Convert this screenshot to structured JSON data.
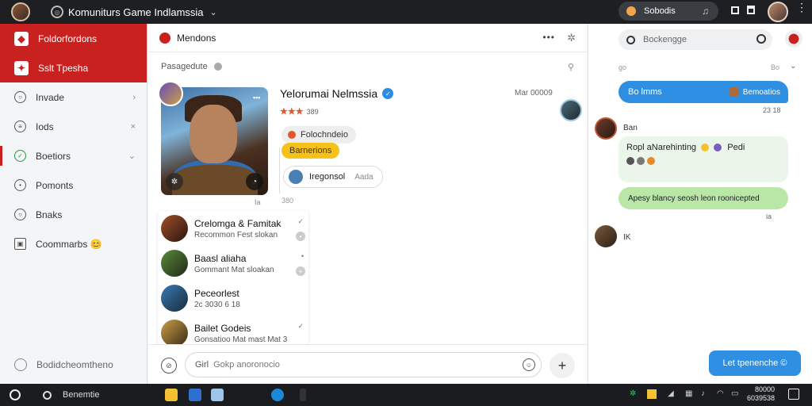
{
  "titlebar": {
    "title": "Komuniturs Game Indlamssia",
    "pill_label": "Sobodis"
  },
  "sidebar": {
    "items": [
      {
        "label": "Foldorfordons"
      },
      {
        "label": "Sslt Tpesha"
      },
      {
        "label": "Invade"
      },
      {
        "label": "Iods"
      },
      {
        "label": "Boetiors"
      },
      {
        "label": "Pomonts"
      },
      {
        "label": "Bnaks"
      },
      {
        "label": "Coommarbs 😊"
      }
    ],
    "bottom_label": "Bodidcheomtheno"
  },
  "middle": {
    "header_title": "Mendons",
    "header_dots": "•••",
    "sub_label": "Pasagedute",
    "profile_name": "Yelorumai Nelmssia",
    "profile_time": "Mar 00009",
    "rating_text": "389",
    "stars": "★★★",
    "chip1": "Folochndeio",
    "chip2": "Barnerions",
    "chip3_main": "Iregonsol",
    "chip3_side": "Aada",
    "hero_caption": "Ia",
    "hero_count": "380",
    "hero_dots": "•••",
    "contacts": [
      {
        "name": "Crelomga & Famitak",
        "sub": "Recommon Fest slokan",
        "right": "✓"
      },
      {
        "name": "Baasl aliaha",
        "sub": "Gommant Mat sloakan",
        "right": "•"
      },
      {
        "name": "Peceorlest",
        "sub": "2c 3030 6 18",
        "right": ""
      },
      {
        "name": "Bailet Godeis",
        "sub": "Gonsatioo Mat mast Mat 3",
        "right": "✓"
      }
    ],
    "composer_placeholder": "Gokp anoronocio",
    "composer_prefix": "Girl"
  },
  "right": {
    "search_placeholder": "Bockengge",
    "top_left": "go",
    "top_right": "Bo",
    "bubble1_text": "Bo lmms",
    "bubble1_tag": "Bemoatios",
    "meta1": "23 18",
    "name1": "Ban",
    "bubble_in_text": "Ropl aNarehinting",
    "bubble_in_tail": "Pedi",
    "bubble2_text": "Apesy blancy seosh leon roonicepted",
    "meta2": "ia",
    "name2": "IK",
    "button_label": "Let tpenenche ©"
  },
  "taskbar": {
    "search_label": "Benemtie",
    "clock_line1": "80000",
    "clock_line2": "6039538"
  },
  "colors": {
    "accent_red": "#c8211f",
    "accent_blue": "#2e8fe3",
    "bubble_green": "#b9e7a7",
    "chip_yellow": "#f6c21a"
  }
}
